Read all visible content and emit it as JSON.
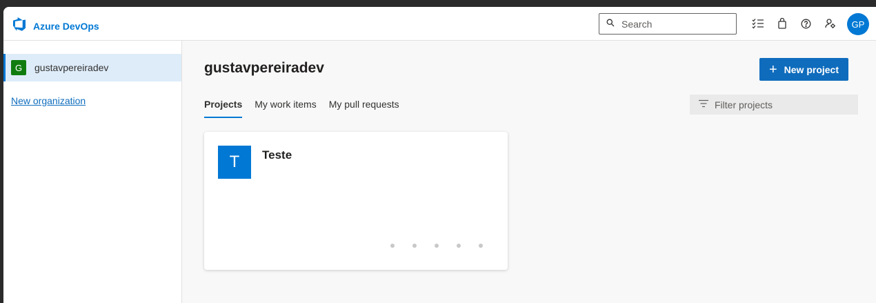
{
  "header": {
    "app_name": "Azure DevOps",
    "search_placeholder": "Search",
    "icons": [
      "work-items-checklist-icon",
      "marketplace-bag-icon",
      "help-icon",
      "user-settings-icon"
    ],
    "avatar_initials": "GP"
  },
  "sidebar": {
    "organizations": [
      {
        "initial": "G",
        "name": "gustavpereiradev",
        "badge_color": "#107c10",
        "selected": true
      }
    ],
    "new_organization_label": "New organization"
  },
  "main": {
    "title": "gustavpereiradev",
    "new_project_label": "New project",
    "tabs": [
      {
        "label": "Projects",
        "active": true
      },
      {
        "label": "My work items",
        "active": false
      },
      {
        "label": "My pull requests",
        "active": false
      }
    ],
    "filter_placeholder": "Filter projects",
    "projects": [
      {
        "initial": "T",
        "name": "Teste",
        "tile_color": "#0078d4"
      }
    ]
  },
  "colors": {
    "accent": "#0078d4",
    "primary_button": "#0f6cbd"
  }
}
